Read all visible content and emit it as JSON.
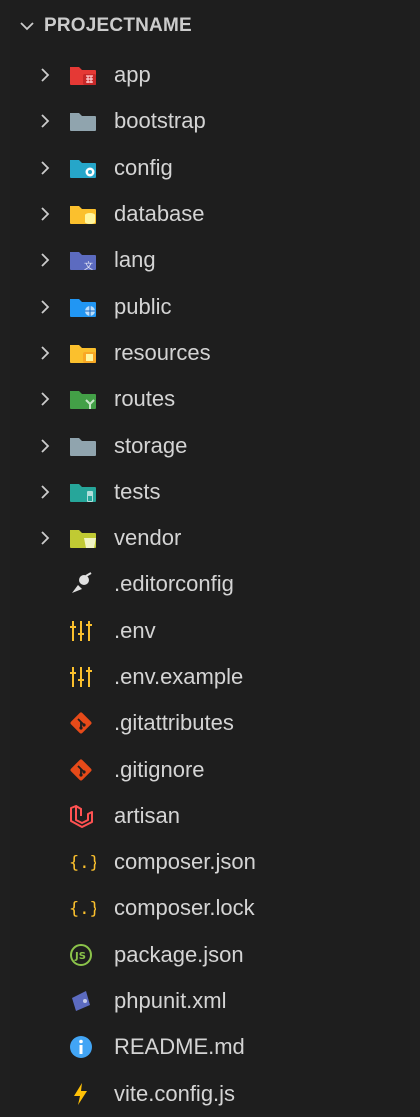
{
  "explorer": {
    "project_name": "PROJECTNAME"
  },
  "colors": {
    "background": "#1e1e1e",
    "text": "#cccccc"
  },
  "items": [
    {
      "label": "app",
      "type": "folder",
      "icon": "app-folder-icon",
      "color": "#e53935"
    },
    {
      "label": "bootstrap",
      "type": "folder",
      "icon": "folder-icon",
      "color": "#90a4ae"
    },
    {
      "label": "config",
      "type": "folder",
      "icon": "config-folder-icon",
      "color": "#26a6c9"
    },
    {
      "label": "database",
      "type": "folder",
      "icon": "database-folder-icon",
      "color": "#fbc02d"
    },
    {
      "label": "lang",
      "type": "folder",
      "icon": "lang-folder-icon",
      "color": "#5c6bc0"
    },
    {
      "label": "public",
      "type": "folder",
      "icon": "public-folder-icon",
      "color": "#2196f3"
    },
    {
      "label": "resources",
      "type": "folder",
      "icon": "resources-folder-icon",
      "color": "#fbc02d"
    },
    {
      "label": "routes",
      "type": "folder",
      "icon": "routes-folder-icon",
      "color": "#43a047"
    },
    {
      "label": "storage",
      "type": "folder",
      "icon": "folder-icon",
      "color": "#90a4ae"
    },
    {
      "label": "tests",
      "type": "folder",
      "icon": "tests-folder-icon",
      "color": "#26a69a"
    },
    {
      "label": "vendor",
      "type": "folder",
      "icon": "vendor-folder-icon",
      "color": "#c0ca33"
    },
    {
      "label": ".editorconfig",
      "type": "file",
      "icon": "editorconfig-icon",
      "color": "#e0e0e0"
    },
    {
      "label": ".env",
      "type": "file",
      "icon": "env-tune-icon",
      "color": "#fbc02d"
    },
    {
      "label": ".env.example",
      "type": "file",
      "icon": "env-tune-icon",
      "color": "#fbc02d"
    },
    {
      "label": ".gitattributes",
      "type": "file",
      "icon": "git-icon",
      "color": "#e64a19"
    },
    {
      "label": ".gitignore",
      "type": "file",
      "icon": "git-icon",
      "color": "#e64a19"
    },
    {
      "label": "artisan",
      "type": "file",
      "icon": "laravel-icon",
      "color": "#ff5252"
    },
    {
      "label": "composer.json",
      "type": "file",
      "icon": "json-braces-icon",
      "color": "#fbc02d"
    },
    {
      "label": "composer.lock",
      "type": "file",
      "icon": "json-braces-icon",
      "color": "#fbc02d"
    },
    {
      "label": "package.json",
      "type": "file",
      "icon": "nodejs-icon",
      "color": "#8bc34a"
    },
    {
      "label": "phpunit.xml",
      "type": "file",
      "icon": "phpunit-icon",
      "color": "#5c6bc0"
    },
    {
      "label": "README.md",
      "type": "file",
      "icon": "info-icon",
      "color": "#42a5f5"
    },
    {
      "label": "vite.config.js",
      "type": "file",
      "icon": "vite-bolt-icon",
      "color": "#ffc107"
    }
  ]
}
